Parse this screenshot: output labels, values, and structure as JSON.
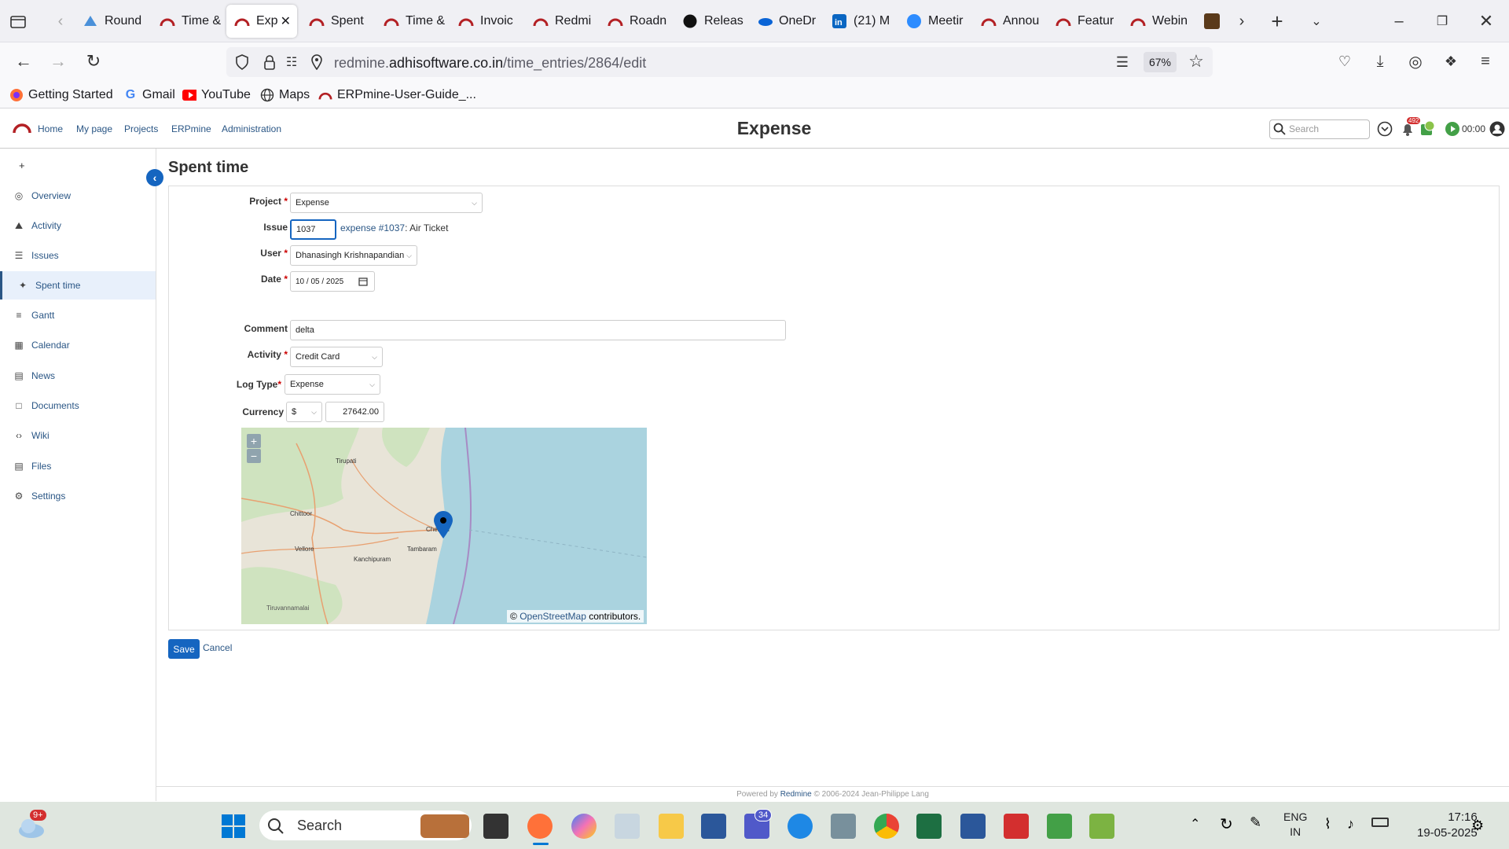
{
  "browser": {
    "tabs": [
      {
        "label": "Round",
        "icon": "drive-icon"
      },
      {
        "label": "Time &",
        "icon": "redmine-icon"
      },
      {
        "label": "Exp",
        "icon": "redmine-icon",
        "active": true
      },
      {
        "label": "Spent",
        "icon": "redmine-icon"
      },
      {
        "label": "Time &",
        "icon": "redmine-icon"
      },
      {
        "label": "Invoic",
        "icon": "redmine-icon"
      },
      {
        "label": "Redmi",
        "icon": "redmine-icon"
      },
      {
        "label": "Roadn",
        "icon": "redmine-icon"
      },
      {
        "label": "Releas",
        "icon": "github-icon"
      },
      {
        "label": "OneDr",
        "icon": "onedrive-icon"
      },
      {
        "label": "(21) M",
        "icon": "linkedin-icon"
      },
      {
        "label": "Meetir",
        "icon": "zoom-icon"
      },
      {
        "label": "Annou",
        "icon": "redmine-icon"
      },
      {
        "label": "Featur",
        "icon": "redmine-icon"
      },
      {
        "label": "Webin",
        "icon": "redmine-icon"
      }
    ],
    "url_domain_prefix": "redmine.",
    "url_domain": "adhisoftware.co.in",
    "url_path": "/time_entries/2864/edit",
    "zoom": "67%",
    "bookmarks": [
      "Getting Started",
      "Gmail",
      "YouTube",
      "Maps",
      "ERPmine-User-Guide_..."
    ]
  },
  "redmine": {
    "top_menu": [
      "Home",
      "My page",
      "Projects",
      "ERPmine",
      "Administration"
    ],
    "project_title": "Expense",
    "search_placeholder": "Search",
    "timer": "00:00",
    "notification_count": "492",
    "sidebar_plus": "+",
    "sidebar": [
      "Overview",
      "Activity",
      "Issues",
      "Spent time",
      "Gantt",
      "Calendar",
      "News",
      "Documents",
      "Wiki",
      "Files",
      "Settings"
    ],
    "selected_sidebar": "Spent time"
  },
  "form": {
    "page_title": "Spent time",
    "project_label": "Project",
    "project_value": "Expense",
    "issue_label": "Issue",
    "issue_value": "1037",
    "issue_link": "expense #1037",
    "issue_subject": ": Air Ticket",
    "user_label": "User",
    "user_value": "Dhanasingh Krishnapandian",
    "date_label": "Date",
    "date_value": "10 / 05 / 2025",
    "comment_label": "Comment",
    "comment_value": "delta",
    "activity_label": "Activity",
    "activity_value": "Credit Card",
    "logtype_label": "Log Type",
    "logtype_value": "Expense",
    "currency_label": "Currency",
    "currency_value": "$",
    "amount_value": "27642.00",
    "save_label": "Save",
    "cancel_label": "Cancel",
    "required_mark": "*"
  },
  "map": {
    "zoom_in": "+",
    "zoom_out": "−",
    "attribution_prefix": "© ",
    "attribution_link": "OpenStreetMap",
    "attribution_suffix": " contributors.",
    "places": [
      "Tirupati",
      "Chittoor",
      "Vellore",
      "Kanchipuram",
      "Tambaram",
      "Chennai",
      "Tiruvannamalai"
    ]
  },
  "footer": {
    "prefix": "Powered by ",
    "link": "Redmine",
    "suffix": " © 2006-2024 Jean-Philippe Lang"
  },
  "taskbar": {
    "weather_badge": "9+",
    "search": "Search",
    "teams_badge": "34",
    "lang_1": "ENG",
    "lang_2": "IN",
    "time": "17:16",
    "date": "19-05-2025"
  }
}
